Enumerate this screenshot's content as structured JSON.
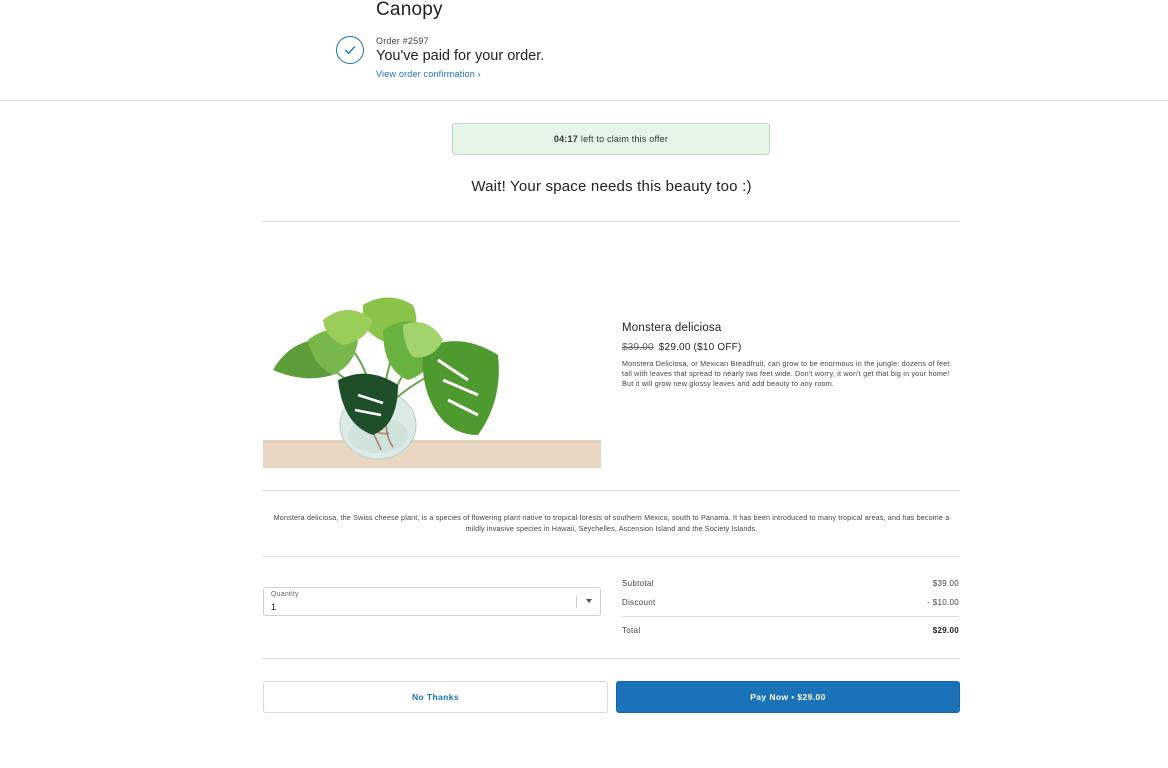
{
  "header": {
    "brand": "Canopy",
    "order_number": "Order #2597",
    "paid_message": "You've paid for your order.",
    "view_link": "View order confirmation ›"
  },
  "offer": {
    "timer": "04:17",
    "timer_text": "left to claim this offer",
    "headline": "Wait! Your space needs this beauty too :)"
  },
  "product": {
    "name": "Monstera deliciosa",
    "old_price": "$39.00",
    "new_price": "$29.00 ($10 OFF)",
    "short_description": "Monstera Deliciosa, or Mexican Breadfruit, can grow to be enormous in the jungle: dozens of feet tall with leaves that spread to nearly two feet wide. Don't worry, it won't get that big in your home! But it will grow new glossy leaves and add beauty to any room.",
    "long_description": "Monstera deliciosa, the Swiss cheese plant, is a species of flowering plant native to tropical forests of southern Mexico, south to Panama. It has been introduced to many tropical areas, and has become a mildly invasive species in Hawaii, Seychelles, Ascension Island and the Society Islands."
  },
  "quantity": {
    "label": "Quantity",
    "value": "1"
  },
  "summary": {
    "subtotal_label": "Subtotal",
    "subtotal_value": "$39.00",
    "discount_label": "Discount",
    "discount_value": "- $10.00",
    "total_label": "Total",
    "total_value": "$29.00"
  },
  "actions": {
    "no_thanks": "No Thanks",
    "pay_now": "Pay Now • $29.00"
  },
  "colors": {
    "accent": "#1a73b8",
    "timer_bg": "#e6f5e8"
  },
  "icons": {
    "check": "check-circle-icon",
    "dropdown": "chevron-down-icon"
  }
}
